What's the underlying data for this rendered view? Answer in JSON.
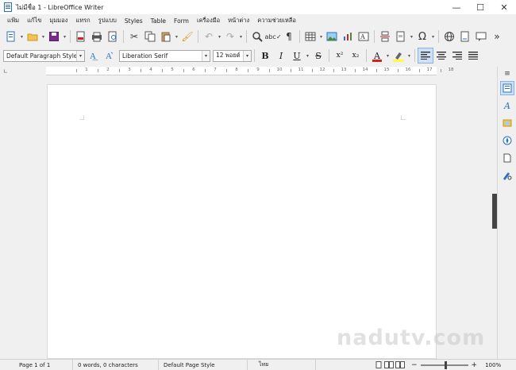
{
  "window": {
    "title": "ไม่มีชื่อ 1 - LibreOffice Writer",
    "minimize_glyph": "—",
    "maximize_glyph": "☐",
    "close_glyph": "✕"
  },
  "menubar": {
    "items": [
      "แฟ้ม",
      "แก้ไข",
      "มุมมอง",
      "แทรก",
      "รูปแบบ",
      "Styles",
      "Table",
      "Form",
      "เครื่องมือ",
      "หน้าต่าง",
      "ความช่วยเหลือ"
    ]
  },
  "standard_toolbar": {
    "icons": [
      "new-document-icon",
      "open-folder-icon",
      "save-icon",
      "export-pdf-icon",
      "print-icon",
      "print-preview-icon",
      "cut-icon",
      "copy-icon",
      "paste-icon",
      "clone-formatting-icon",
      "undo-icon",
      "redo-icon",
      "find-replace-icon",
      "spelling-icon",
      "formatting-marks-icon",
      "insert-table-icon",
      "insert-image-icon",
      "insert-chart-icon",
      "insert-textbox-icon",
      "page-break-icon",
      "insert-field-icon",
      "special-character-icon",
      "hyperlink-icon",
      "footnote-icon",
      "comment-icon",
      "more-icon"
    ],
    "glyphs": {
      "overflow": "»"
    }
  },
  "formatting_toolbar": {
    "paragraph_style": "Default Paragraph Style",
    "font_name": "Liberation Serif",
    "font_size": "12 พอยต์",
    "bold_label": "B",
    "italic_label": "I",
    "underline_label": "U",
    "strikethrough_label": "S",
    "superscript_label": "x²",
    "subscript_label": "x₂",
    "font_color_label": "A",
    "font_color": "#d42020",
    "highlight_color": "#ffff38",
    "accent_color": "#2a6fc9"
  },
  "ruler": {
    "corner_glyph": "∟",
    "numbers": [
      "1",
      "2",
      "3",
      "4",
      "5",
      "6",
      "7",
      "8",
      "9",
      "10",
      "11",
      "12",
      "13",
      "14",
      "15",
      "16",
      "17",
      "18"
    ]
  },
  "sidebar": {
    "buttons": [
      "properties-icon",
      "styles-icon",
      "gallery-icon",
      "navigator-icon",
      "page-icon",
      "style-inspector-icon"
    ],
    "menu_glyph": "≡"
  },
  "statusbar": {
    "page": "Page 1 of 1",
    "words": "0 words, 0 characters",
    "page_style": "Default Page Style",
    "language": "ไทย",
    "zoom": "100%"
  },
  "watermark": "nadutv.com"
}
